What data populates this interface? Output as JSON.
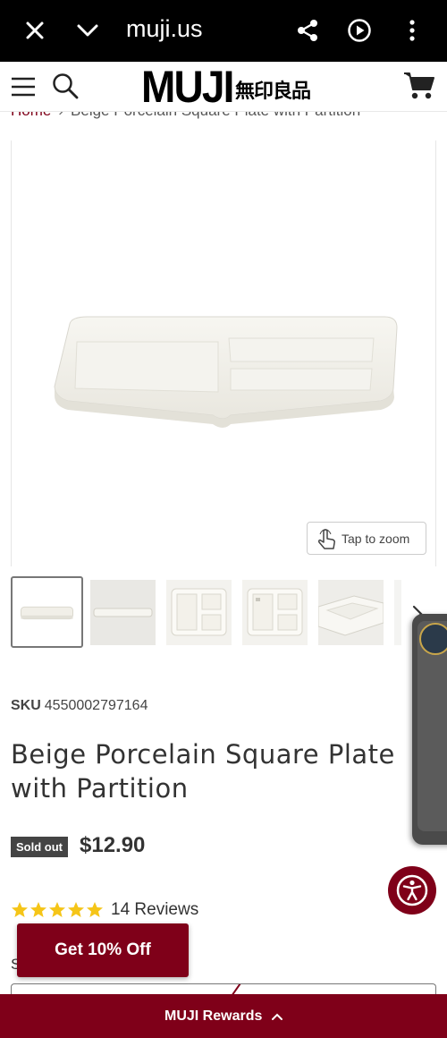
{
  "browser": {
    "url": "muji.us",
    "icons": [
      "close-icon",
      "chevron-down-icon",
      "share-icon",
      "play-circle-icon",
      "more-vertical-icon"
    ]
  },
  "header": {
    "logo_latin": "MUJI",
    "logo_kanji": "無印良品",
    "icons": [
      "menu-icon",
      "search-icon",
      "cart-icon"
    ]
  },
  "breadcrumb": {
    "home": "Home",
    "separator": "›",
    "current": "Beige Porcelain Square Plate with Partition"
  },
  "gallery": {
    "zoom_label": "Tap to zoom",
    "thumbnail_count_visible": 5
  },
  "product": {
    "sku_label": "SKU",
    "sku_value": "4550002797164",
    "title": "Beige Porcelain Square Plate with Partition",
    "badge": "Sold out",
    "price": "$12.90",
    "rating": 5,
    "reviews": "14 Reviews",
    "partial_label": "S"
  },
  "promo": {
    "label": "Get 10% Off"
  },
  "rewards": {
    "label": "MUJI Rewards"
  },
  "colors": {
    "brand": "#7f0019",
    "star": "#f5c518",
    "browser_bar": "#000000"
  }
}
